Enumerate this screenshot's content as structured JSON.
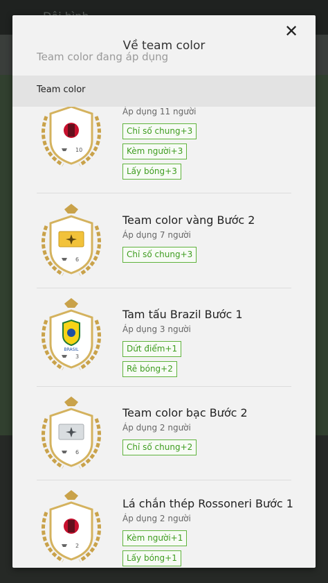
{
  "background": {
    "title": "Đội hình"
  },
  "modal": {
    "title": "Về team color",
    "close_label": "✕",
    "subtitle": "Team color đang áp dụng",
    "section_label": "Team color"
  },
  "items": [
    {
      "badge_type": "milan",
      "level": "10",
      "name": "",
      "applied": "Áp dụng 11 người",
      "tags": [
        "Chỉ số chung+3",
        "Kèm người+3",
        "Lấy bóng+3"
      ]
    },
    {
      "badge_type": "gold",
      "level": "6",
      "name": "Team color vàng Bước 2",
      "applied": "Áp dụng 7 người",
      "tags": [
        "Chỉ số chung+3"
      ]
    },
    {
      "badge_type": "brazil",
      "level": "3",
      "name": "Tam tấu Brazil Bước 1",
      "applied": "Áp dụng 3 người",
      "tags": [
        "Dứt điểm+1",
        "Rê bóng+2"
      ]
    },
    {
      "badge_type": "silver",
      "level": "6",
      "name": "Team color bạc Bước 2",
      "applied": "Áp dụng 2 người",
      "tags": [
        "Chỉ số chung+2"
      ]
    },
    {
      "badge_type": "milan",
      "level": "2",
      "name": "Lá chắn thép Rossoneri Bước 1",
      "applied": "Áp dụng 2 người",
      "tags": [
        "Kèm người+1",
        "Lấy bóng+1"
      ]
    }
  ],
  "colors": {
    "tag_border": "#5fb33c",
    "tag_text": "#3e9c1f",
    "section_bg": "#e3e3e3"
  },
  "icons": [
    "close-icon",
    "laurel-icon",
    "team-badge-icon"
  ]
}
